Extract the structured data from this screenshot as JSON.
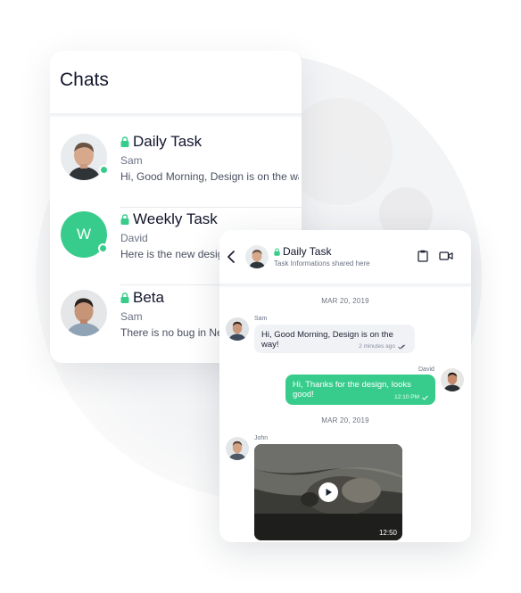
{
  "chats": {
    "title": "Chats",
    "items": [
      {
        "name": "Daily Task",
        "sender": "Sam",
        "preview": "Hi, Good Morning, Design is on the way!",
        "online": true,
        "avatar": "photo"
      },
      {
        "name": "Weekly Task",
        "sender": "David",
        "preview": "Here is the new design",
        "online": true,
        "avatar": "letter",
        "avatar_letter": "W"
      },
      {
        "name": "Beta",
        "sender": "Sam",
        "preview": "There is no bug in New",
        "online": false,
        "avatar": "photo"
      }
    ]
  },
  "conversation": {
    "title": "Daily Task",
    "subtitle": "Task Informations shared here",
    "dates": [
      "MAR 20, 2019",
      "MAR 20, 2019"
    ],
    "messages": [
      {
        "sender": "Sam",
        "text": "Hi, Good Morning, Design is on the way!",
        "time": "2 minutes ago",
        "direction": "in"
      },
      {
        "sender": "David",
        "text": "Hi, Thanks for the design, looks good!",
        "time": "12:10 PM",
        "direction": "out"
      },
      {
        "sender": "John",
        "type": "video",
        "duration": "12:50",
        "direction": "in"
      }
    ]
  },
  "icons": {
    "lock": "lock-icon",
    "back": "chevron-left-icon",
    "clipboard": "clipboard-icon",
    "video": "video-camera-icon",
    "play": "play-icon",
    "check": "check-icon"
  },
  "colors": {
    "accent": "#38cc8c",
    "title_text": "#12152b",
    "muted_text": "#6c7383",
    "bubble_incoming": "#f1f2f6"
  }
}
